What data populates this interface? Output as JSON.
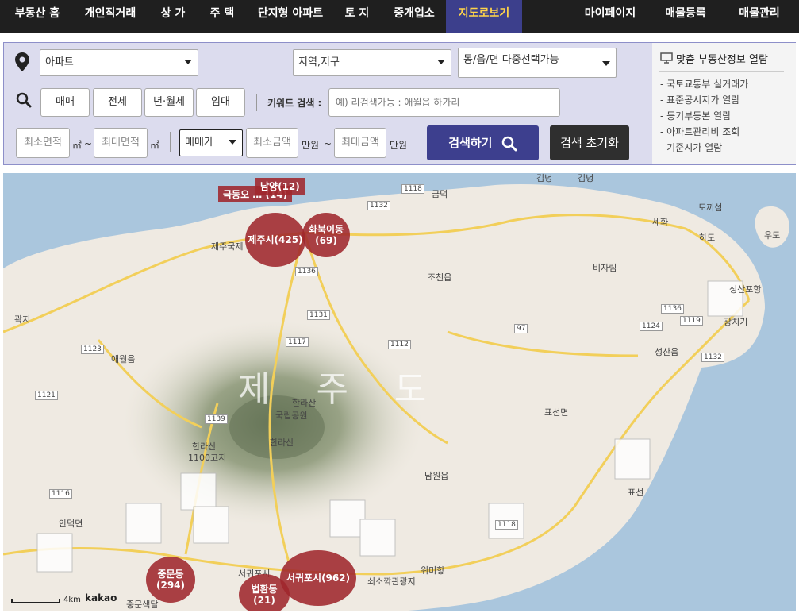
{
  "nav": {
    "items": [
      "부동산 홈",
      "개인직거래",
      "상 가",
      "주 택",
      "단지형 아파트",
      "토 지",
      "중개업소",
      "지도로보기",
      "마이페이지",
      "매물등록",
      "매물관리"
    ],
    "active": "지도로보기"
  },
  "search": {
    "property_type": "아파트",
    "region": "지역,지구",
    "district": "동/읍/면 다중선택가능",
    "deal_types": [
      "매매",
      "전세",
      "년·월세",
      "임대"
    ],
    "keyword_label": "키워드 검색 :",
    "keyword_placeholder": "예) 리검색가능 : 애월읍 하가리",
    "min_area_placeholder": "최소면적",
    "max_area_placeholder": "최대면적",
    "area_unit": "㎡",
    "tilde": "~",
    "price_type": "매매가",
    "min_price_placeholder": "최소금액",
    "max_price_placeholder": "최대금액",
    "price_unit": "만원",
    "search_button": "검색하기",
    "reset_button": "검색 초기화"
  },
  "sidebar": {
    "title": "맞춤 부동산정보 열람",
    "links": [
      "- 국토교통부 실거래가",
      "- 표준공시지가 열람",
      "- 등기부등본 열람",
      "- 아파트관리비 조회",
      "- 기준시가 열람"
    ]
  },
  "map": {
    "island_label": "제 주 도",
    "places": [
      "제주국제",
      "조천읍",
      "비자림",
      "세화",
      "토끼섬",
      "하도",
      "우도",
      "성산포항",
      "광치기",
      "성산읍",
      "표선면",
      "남원읍",
      "애월읍",
      "한라산",
      "국립공원",
      "한라산",
      "한라산",
      "1100고지",
      "안덕면",
      "서귀포시",
      "쇠소깍관광지",
      "위미항",
      "중문색달",
      "금덕",
      "김녕",
      "김녕",
      "곽지",
      "표선"
    ],
    "road_numbers": [
      "1118",
      "1132",
      "1136",
      "1131",
      "1117",
      "1112",
      "97",
      "1124",
      "1119",
      "1136",
      "1132",
      "1123",
      "1121",
      "1139",
      "1116",
      "1118"
    ],
    "clusters": [
      {
        "label": "남양(12)"
      },
      {
        "label": "극동오 … (14)"
      },
      {
        "label": "제주시(425)"
      },
      {
        "label": "화북이동",
        "count": "(69)"
      },
      {
        "label": "중문동",
        "count": "(294)"
      },
      {
        "label": "법환동",
        "count": "(21)"
      },
      {
        "label": "서귀포시(962)"
      }
    ],
    "scale_label": "4km",
    "brand": "kakao"
  },
  "colors": {
    "nav_bg": "#1f1f1f",
    "nav_active_bg": "#3c3f8c",
    "nav_active_text": "#ffd44a",
    "panel_bg": "#dcdcee",
    "search_button": "#3d3f8e",
    "cluster": "#9f272c",
    "sea": "#aac6dd",
    "land": "#efeae2"
  }
}
